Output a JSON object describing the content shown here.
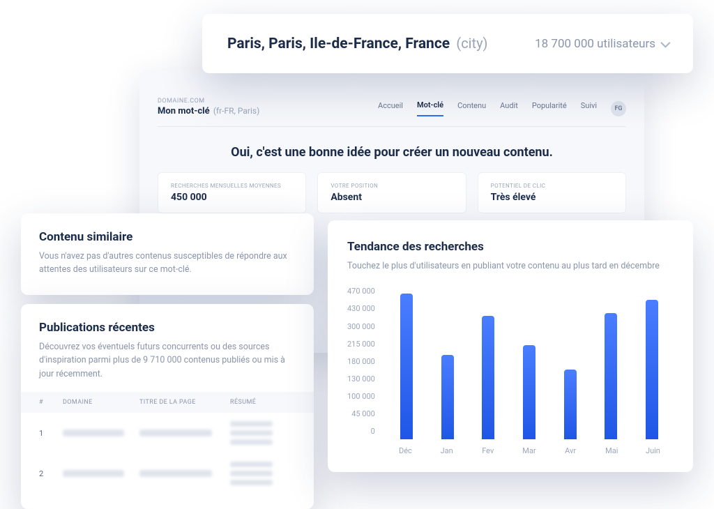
{
  "top_bar": {
    "location": "Paris, Paris, Ile-de-France, France",
    "type_suffix": "(city)",
    "users_text": "18 700 000 utilisateurs"
  },
  "dashboard": {
    "domain_label": "DOMAINE.COM",
    "keyword": "Mon mot-clé",
    "keyword_meta": "(fr-FR, Paris)",
    "nav": {
      "accueil": "Accueil",
      "motcle": "Mot-clé",
      "contenu": "Contenu",
      "audit": "Audit",
      "popularite": "Popularité",
      "suivi": "Suivi",
      "avatar": "FG"
    },
    "headline": "Oui, c'est une bonne idée pour créer un nouveau contenu.",
    "stats": {
      "searches": {
        "label": "RECHERCHES MENSUELLES MOYENNES",
        "value": "450 000"
      },
      "position": {
        "label": "VOTRE POSITION",
        "value": "Absent"
      },
      "potential": {
        "label": "POTENTIEL DE CLIC",
        "value": "Très élevé"
      }
    }
  },
  "similar": {
    "title": "Contenu similaire",
    "desc": "Vous n'avez pas d'autres contenus susceptibles de répondre aux attentes des utilisateurs sur ce mot-clé."
  },
  "pubs": {
    "title": "Publications récentes",
    "desc": "Découvrez vos éventuels futurs concurrents ou des sources d'inspiration parmi plus de 9 710 000 contenus publiés ou mis à jour récemment.",
    "cols": {
      "num": "#",
      "domain": "DOMAINE",
      "page_title": "TITRE DE LA PAGE",
      "summary": "RÉSUMÉ"
    },
    "rows": [
      {
        "idx": "1"
      },
      {
        "idx": "2"
      }
    ]
  },
  "trend": {
    "title": "Tendance des recherches",
    "desc": "Touchez le plus d'utilisateurs en publiant votre contenu au plus tard en décembre"
  },
  "chart_data": {
    "type": "bar",
    "categories": [
      "Déc",
      "Jan",
      "Fev",
      "Mar",
      "Avr",
      "Mai",
      "Juin"
    ],
    "values": [
      450000,
      260000,
      380000,
      290000,
      215000,
      390000,
      430000
    ],
    "y_ticks": [
      "470 000",
      "430 000",
      "300 000",
      "215 000",
      "180 000",
      "130 000",
      "100 000",
      "45 000",
      "0"
    ],
    "ylim": [
      0,
      470000
    ],
    "title": "Tendance des recherches",
    "xlabel": "",
    "ylabel": ""
  }
}
